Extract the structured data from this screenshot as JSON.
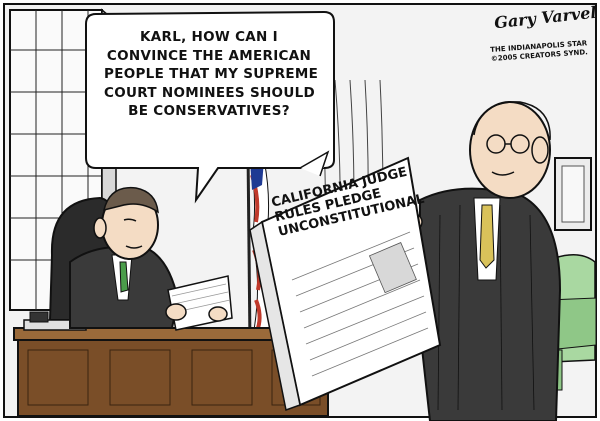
{
  "speech_bubble": {
    "lines": [
      "KARL, HOW CAN I",
      "CONVINCE THE AMERICAN",
      "PEOPLE THAT MY SUPREME",
      "COURT NOMINEES SHOULD",
      "BE CONSERVATIVES?"
    ]
  },
  "newspaper": {
    "headline_lines": [
      "CALIFORNIA JUDGE",
      "RULES PLEDGE",
      "UNCONSTITUTIONAL"
    ]
  },
  "artist": {
    "signature": "Gary Varvel",
    "credit_lines": [
      "THE INDIANAPOLIS STAR",
      "©2005 CREATORS SYND."
    ]
  },
  "colors": {
    "ink": "#111111",
    "wall": "#f3f3f3",
    "flag_red": "#c0392b",
    "flag_blue": "#1f3a93",
    "suit": "#3a3a3a",
    "skin": "#f4dcc4"
  }
}
